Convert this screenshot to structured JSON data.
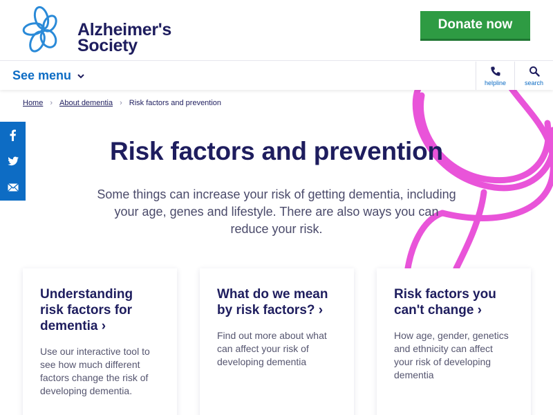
{
  "header": {
    "logo_text_line1": "Alzheimer's",
    "logo_text_line2": "Society",
    "donate_label": "Donate now"
  },
  "nav": {
    "menu_label": "See menu",
    "helpline_label": "helpline",
    "search_label": "search"
  },
  "breadcrumb": {
    "items": [
      "Home",
      "About dementia"
    ],
    "current": "Risk factors and prevention"
  },
  "hero": {
    "title": "Risk factors and prevention",
    "intro": "Some things can increase your risk of getting dementia, including your age, genes and lifestyle. There are also ways you can reduce your risk."
  },
  "cards": [
    {
      "title": "Understanding risk factors for dementia",
      "body": "Use our interactive tool to see how much different factors change the risk of developing dementia."
    },
    {
      "title": "What do we mean by risk factors?",
      "body": "Find out more about what can affect your risk of developing dementia"
    },
    {
      "title": "Risk factors you can't change",
      "body": "How age, gender, genetics and ethnicity can affect your risk of developing dementia"
    }
  ],
  "social": [
    "facebook-icon",
    "twitter-icon",
    "email-icon"
  ],
  "colors": {
    "navy": "#1e1d5e",
    "blue": "#0d6cc4",
    "green": "#2e9b43",
    "pink": "#e84bd8"
  }
}
